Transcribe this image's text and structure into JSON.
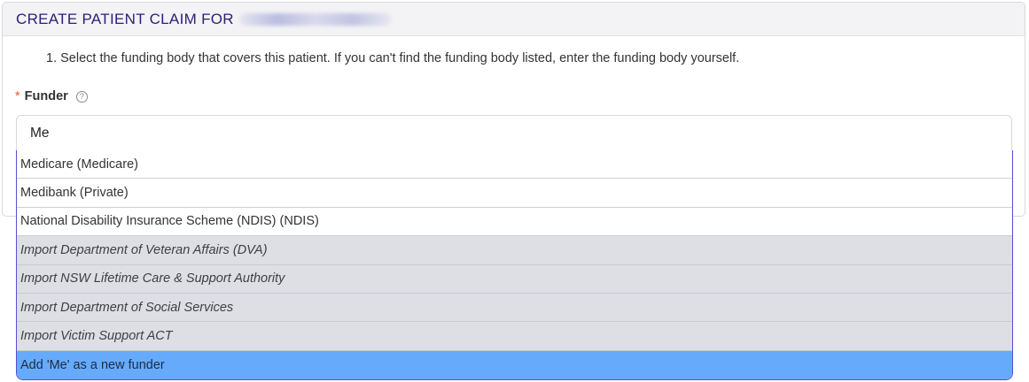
{
  "header": {
    "title": "CREATE PATIENT CLAIM FOR"
  },
  "step": {
    "text": "1. Select the funding body that covers this patient. If you can't find the funding body listed, enter the funding body yourself."
  },
  "funder": {
    "required_mark": "*",
    "label": "Funder",
    "help_icon": "?",
    "value": "Me"
  },
  "dropdown": {
    "options": [
      {
        "label": "Medicare (Medicare)",
        "kind": "existing"
      },
      {
        "label": "Medibank (Private)",
        "kind": "existing"
      },
      {
        "label": "National Disability Insurance Scheme (NDIS) (NDIS)",
        "kind": "existing"
      },
      {
        "label": "Import Department of Veteran Affairs (DVA)",
        "kind": "import"
      },
      {
        "label": "Import NSW Lifetime Care & Support Authority",
        "kind": "import"
      },
      {
        "label": "Import Department of Social Services",
        "kind": "import"
      },
      {
        "label": "Import Victim Support ACT",
        "kind": "import"
      }
    ],
    "add_new": "Add 'Me' as a new funder"
  },
  "colors": {
    "title": "#2b2178",
    "focus_border": "#5b4fd1",
    "import_bg": "#dddfe4",
    "highlight_bg": "#66abfb",
    "required": "#e05a47"
  }
}
